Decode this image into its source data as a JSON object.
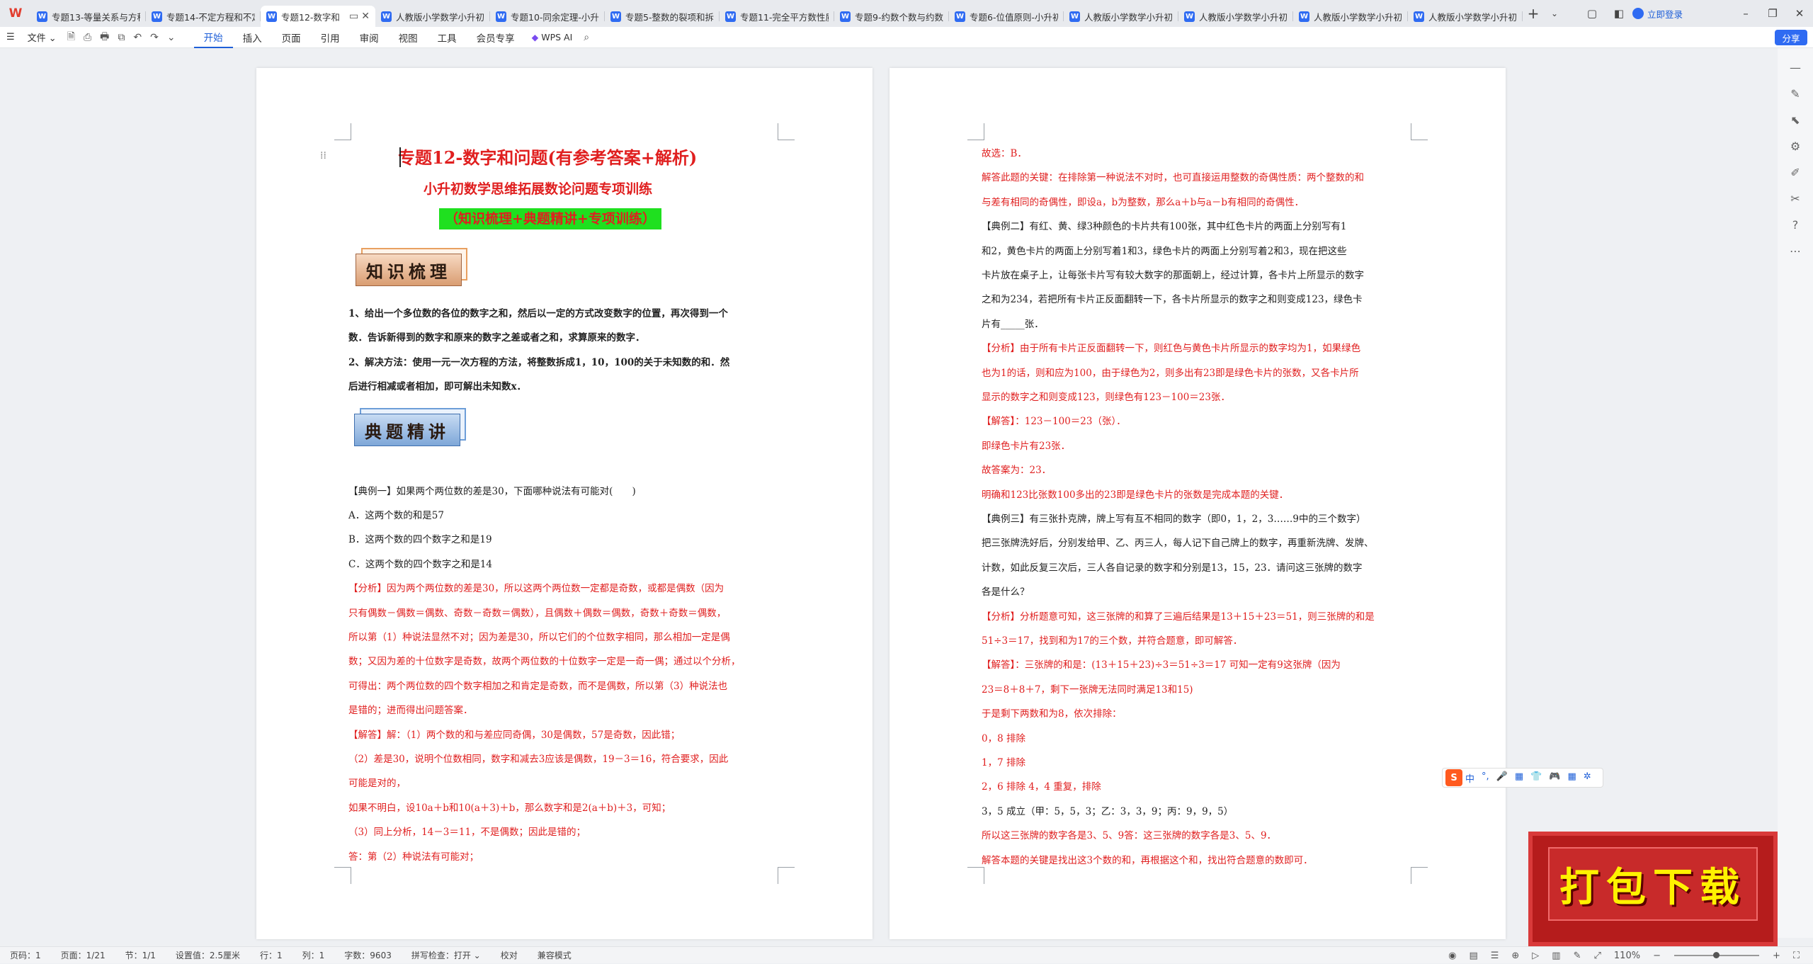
{
  "tabs": [
    {
      "label": "专题13-等量关系与方程",
      "active": false
    },
    {
      "label": "专题14-不定方程和不定方",
      "active": false
    },
    {
      "label": "专题12-数字和",
      "active": true
    },
    {
      "label": "人教版小学数学小升初",
      "active": false
    },
    {
      "label": "专题10-同余定理-小升",
      "active": false
    },
    {
      "label": "专题5-整数的裂项和拆",
      "active": false
    },
    {
      "label": "专题11-完全平方数性质",
      "active": false
    },
    {
      "label": "专题9-约数个数与约数",
      "active": false
    },
    {
      "label": "专题6-位值原则-小升初",
      "active": false
    },
    {
      "label": "人教版小学数学小升初",
      "active": false
    },
    {
      "label": "人教版小学数学小升初",
      "active": false
    },
    {
      "label": "人教版小学数学小升初",
      "active": false
    },
    {
      "label": "人教版小学数学小升初",
      "active": false
    }
  ],
  "window": {
    "login": "立即登录",
    "share": "分享"
  },
  "toolbar": {
    "file": "文件",
    "menus": [
      "开始",
      "插入",
      "页面",
      "引用",
      "审阅",
      "视图",
      "工具",
      "会员专享"
    ],
    "wps_ai": "WPS AI"
  },
  "page1": {
    "title1": "专题12-数字和问题(有参考答案+解析)",
    "title2": "小升初数学思维拓展数论问题专项训练",
    "title3": "（知识梳理+典题精讲+专项训练）",
    "section1": "知识梳理",
    "section2": "典题精讲",
    "lines": [
      {
        "t": "1、给出一个多位数的各位的数字之和，然后以一定的方式改变数字的位置，再次得到一个",
        "c": "blk bold"
      },
      {
        "t": "数．告诉新得到的数字和原来的数字之差或者之和，求算原来的数字．",
        "c": "blk bold"
      },
      {
        "t": "2、解决方法：使用一元一次方程的方法，将整数拆成1，10，100的关于未知数的和．然",
        "c": "blk bold"
      },
      {
        "t": "后进行相减或者相加，即可解出未知数x．",
        "c": "blk bold"
      },
      {
        "t": "【典例一】如果两个两位数的差是30，下面哪种说法有可能对(　　)",
        "c": "blk",
        "prefix": "【典例一】"
      },
      {
        "t": "A．这两个数的和是57",
        "c": "blk"
      },
      {
        "t": "B．这两个数的四个数字之和是19",
        "c": "blk"
      },
      {
        "t": "C．这两个数的四个数字之和是14",
        "c": "blk"
      },
      {
        "t": "【分析】因为两个两位数的差是30，所以这两个两位数一定都是奇数，或都是偶数（因为",
        "c": "red"
      },
      {
        "t": "只有偶数－偶数＝偶数、奇数－奇数＝偶数），且偶数＋偶数＝偶数，奇数＋奇数＝偶数，",
        "c": "red"
      },
      {
        "t": "所以第（1）种说法显然不对；因为差是30，所以它们的个位数字相同，那么相加一定是偶",
        "c": "red"
      },
      {
        "t": "数；又因为差的十位数字是奇数，故两个两位数的十位数字一定是一奇一偶；通过以个分析，",
        "c": "red"
      },
      {
        "t": "可得出：两个两位数的四个数字相加之和肯定是奇数，而不是偶数，所以第（3）种说法也",
        "c": "red"
      },
      {
        "t": "是错的；进而得出问题答案．",
        "c": "red"
      },
      {
        "t": "【解答】解：（1）两个数的和与差应同奇偶，30是偶数，57是奇数，因此错；",
        "c": "red"
      },
      {
        "t": "（2）差是30，说明个位数相同，数字和减去3应该是偶数，19－3＝16，符合要求，因此",
        "c": "red"
      },
      {
        "t": "可能是对的，",
        "c": "red"
      },
      {
        "t": "如果不明白，设10a＋b和10(a＋3)＋b，那么数字和是2(a＋b)＋3，可知；",
        "c": "red"
      },
      {
        "t": "（3）同上分析，14－3＝11，不是偶数；因此是错的；",
        "c": "red"
      },
      {
        "t": "答：第（2）种说法有可能对；",
        "c": "red"
      }
    ]
  },
  "page2": {
    "lines": [
      {
        "t": "故选：B．",
        "c": "red"
      },
      {
        "t": "解答此题的关键：在排除第一种说法不对时，也可直接运用整数的奇偶性质：两个整数的和",
        "c": "red"
      },
      {
        "t": "与差有相同的奇偶性，即设a，b为整数，那么a＋b与a－b有相同的奇偶性．",
        "c": "red"
      },
      {
        "t": "【典例二】有红、黄、绿3种颜色的卡片共有100张，其中红色卡片的两面上分别写有1",
        "c": "blk"
      },
      {
        "t": "和2，黄色卡片的两面上分别写着1和3，绿色卡片的两面上分别写着2和3，现在把这些",
        "c": "blk"
      },
      {
        "t": "卡片放在桌子上，让每张卡片写有较大数字的那面朝上，经过计算，各卡片上所显示的数字",
        "c": "blk"
      },
      {
        "t": "之和为234，若把所有卡片正反面翻转一下，各卡片所显示的数字之和则变成123，绿色卡",
        "c": "blk"
      },
      {
        "t": "片有_____张．",
        "c": "blk"
      },
      {
        "t": "【分析】由于所有卡片正反面翻转一下，则红色与黄色卡片所显示的数字均为1，如果绿色",
        "c": "red"
      },
      {
        "t": "也为1的话，则和应为100，由于绿色为2，则多出有23即是绿色卡片的张数，又各卡片所",
        "c": "red"
      },
      {
        "t": "显示的数字之和则变成123，则绿色有123－100＝23张．",
        "c": "red"
      },
      {
        "t": "【解答】：123－100＝23（张）．",
        "c": "red"
      },
      {
        "t": "即绿色卡片有23张．",
        "c": "red"
      },
      {
        "t": "故答案为：23．",
        "c": "red"
      },
      {
        "t": "明确和123比张数100多出的23即是绿色卡片的张数是完成本题的关键．",
        "c": "red"
      },
      {
        "t": "【典例三】有三张扑克牌，牌上写有互不相同的数字（即0，1，2，3……9中的三个数字）",
        "c": "blk"
      },
      {
        "t": "把三张牌洗好后，分别发给甲、乙、丙三人，每人记下自己牌上的数字，再重新洗牌、发牌、",
        "c": "blk"
      },
      {
        "t": "计数，如此反复三次后，三人各自记录的数字和分别是13，15，23．请问这三张牌的数字",
        "c": "blk"
      },
      {
        "t": "各是什么？",
        "c": "blk"
      },
      {
        "t": "【分析】分析题意可知，这三张牌的和算了三遍后结果是13＋15＋23＝51，则三张牌的和是",
        "c": "red"
      },
      {
        "t": "51÷3＝17，找到和为17的三个数，并符合题意，即可解答．",
        "c": "red"
      },
      {
        "t": "【解答】：三张牌的和是：(13＋15＋23)÷3＝51÷3＝17 可知一定有9这张牌（因为",
        "c": "red"
      },
      {
        "t": "23＝8＋8＋7，剩下一张牌无法同时满足13和15)",
        "c": "red"
      },
      {
        "t": "于是剩下两数和为8，依次排除：",
        "c": "red"
      },
      {
        "t": "0，8 排除",
        "c": "red"
      },
      {
        "t": "1，7 排除",
        "c": "red"
      },
      {
        "t": "2，6 排除 4，4 重复，排除",
        "c": "red"
      },
      {
        "t": "3，5 成立（甲：5，5，3；乙：3，3，9；丙：9，9，5）",
        "c": "blk"
      },
      {
        "t": "所以这三张牌的数字各是3、5、9答：这三张牌的数字各是3、5、9．",
        "c": "red"
      },
      {
        "t": "解答本题的关键是找出这3个数的和，再根据这个和，找出符合题意的数即可．",
        "c": "red"
      }
    ]
  },
  "ime": {
    "items": [
      "中",
      "°,",
      "🎤",
      "▦",
      "👕",
      "🎮",
      "▦",
      "✲"
    ]
  },
  "promo": {
    "text": "打包下载"
  },
  "statusbar": {
    "page_num": "页码：1",
    "pages": "页面：1/21",
    "section": "节：1/1",
    "setting": "设置值：2.5厘米",
    "row": "行：1",
    "col": "列：1",
    "words": "字数：9603",
    "spell": "拼写检查：打开",
    "proof": "校对",
    "compat": "兼容模式",
    "zoom": "110%"
  }
}
